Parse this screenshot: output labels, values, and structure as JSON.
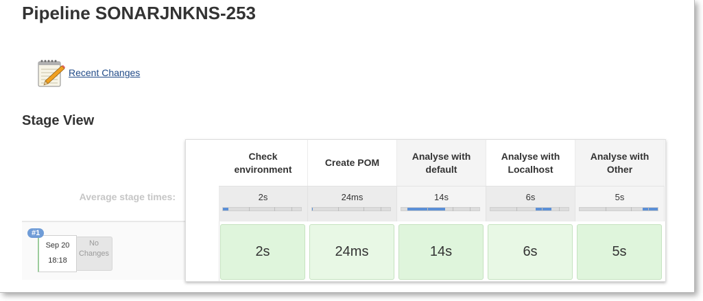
{
  "page": {
    "title": "Pipeline SONARJNKNS-253"
  },
  "recent_changes": {
    "label": "Recent Changes",
    "icon": "notepad-pencil-icon"
  },
  "stage_view": {
    "heading": "Stage View",
    "average_label": "Average stage times:",
    "stages": [
      {
        "name_line1": "Check",
        "name_line2": "environment",
        "avg": "2s",
        "bar_start": 0.0,
        "bar_fraction": 0.07,
        "cell": "2s"
      },
      {
        "name_line1": "Create POM",
        "name_line2": "",
        "avg": "24ms",
        "bar_start": 0.0,
        "bar_fraction": 0.01,
        "cell": "24ms"
      },
      {
        "name_line1": "Analyse with",
        "name_line2": "default",
        "avg": "14s",
        "bar_start": 0.08,
        "bar_fraction": 0.48,
        "cell": "14s"
      },
      {
        "name_line1": "Analyse with",
        "name_line2": "Localhost",
        "avg": "6s",
        "bar_start": 0.58,
        "bar_fraction": 0.2,
        "cell": "6s"
      },
      {
        "name_line1": "Analyse with",
        "name_line2": "Other",
        "avg": "5s",
        "bar_start": 0.81,
        "bar_fraction": 0.19,
        "cell": "5s"
      }
    ]
  },
  "build": {
    "number": "#1",
    "date": "Sep 20",
    "time": "18:18",
    "changes_line1": "No",
    "changes_line2": "Changes"
  },
  "colors": {
    "success_cell": "#dff5dc",
    "progress_bar": "#5b8fd6",
    "link": "#204a87",
    "badge": "#6f9cd7"
  }
}
